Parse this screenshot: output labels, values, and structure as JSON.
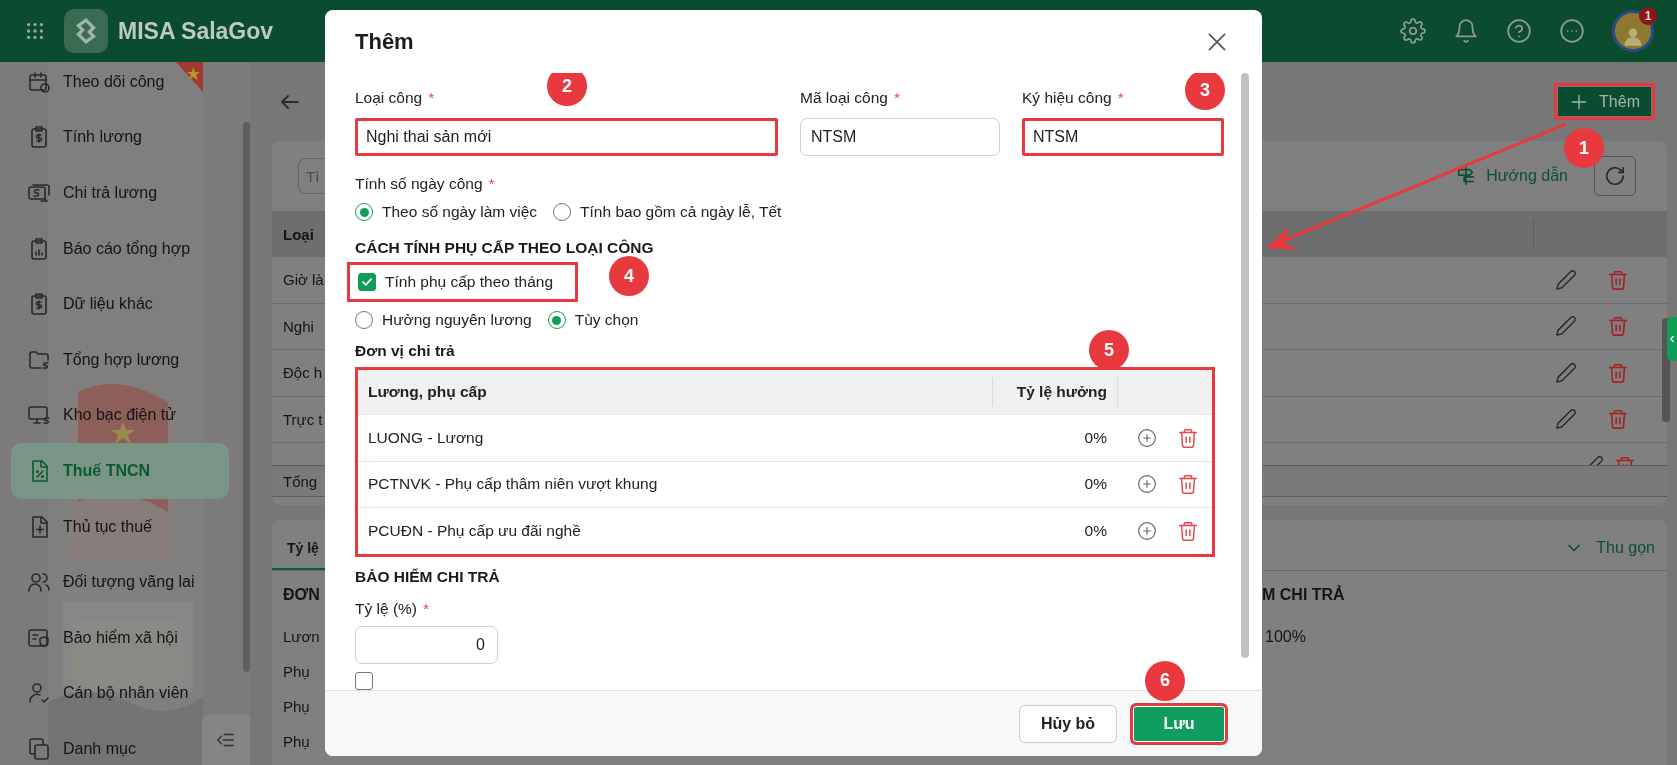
{
  "header": {
    "app_name": "MISA SalaGov",
    "notification_badge": "1"
  },
  "sidebar": {
    "items": [
      {
        "label": "Theo dõi công",
        "selected": false
      },
      {
        "label": "Tính lương",
        "selected": false
      },
      {
        "label": "Chi trả lương",
        "selected": false
      },
      {
        "label": "Báo cáo tổng hợp",
        "selected": false
      },
      {
        "label": "Dữ liệu khác",
        "selected": false
      },
      {
        "label": "Tổng hợp lương",
        "selected": false
      },
      {
        "label": "Kho bạc điện tử",
        "selected": false
      },
      {
        "label": "Thuế TNCN",
        "selected": true
      },
      {
        "label": "Thủ tục thuế",
        "selected": false
      },
      {
        "label": "Đối tượng vãng lai",
        "selected": false
      },
      {
        "label": "Bảo hiểm xã hội",
        "selected": false
      },
      {
        "label": "Cán bộ nhân viên",
        "selected": false
      },
      {
        "label": "Danh mục",
        "selected": false
      }
    ]
  },
  "page": {
    "add_button": {
      "label": "Thêm",
      "highlighted": true,
      "callout": "1"
    },
    "search_placeholder": "Tì",
    "guide_link": "Hướng dẫn",
    "table": {
      "column_1": "Loại",
      "rows": [
        "Giờ là",
        "Nghi",
        "Độc h",
        "Trực t"
      ],
      "footer": "Tổng"
    },
    "detail": {
      "tab": "Tỷ lệ",
      "collapse_link": "Thu gọn",
      "heading_1": "ĐƠN",
      "heading_2": "M CHI TRẢ",
      "lines": [
        "Lươn",
        "Phụ",
        "Phụ",
        "Phụ"
      ],
      "value": "100%"
    }
  },
  "dialog": {
    "title": "Thêm",
    "fields": [
      {
        "label": "Loại công",
        "mark": "*",
        "value": "Nghi thai sản mới",
        "highlighted": true,
        "callout": "2"
      },
      {
        "label": "Mã loại công",
        "mark": "*",
        "value": "NTSM",
        "highlighted": false
      },
      {
        "label": "Ký hiệu công",
        "mark": "*",
        "value": "NTSM",
        "highlighted": true,
        "callout": "3"
      }
    ],
    "workday": {
      "label": "Tính số ngày công",
      "mark": "*",
      "options": [
        {
          "label": "Theo số ngày làm việc",
          "selected": true
        },
        {
          "label": "Tính bao gồm cả ngày lễ, Tết",
          "selected": false
        }
      ]
    },
    "allowance_heading": "CÁCH TÍNH PHỤ CẤP THEO LOẠI CÔNG",
    "monthly_checkbox": {
      "label": "Tính phụ cấp theo tháng",
      "checked": true,
      "highlighted": true,
      "callout": "4"
    },
    "salary_options": [
      {
        "label": "Hưởng nguyên lương",
        "selected": false
      },
      {
        "label": "Tùy chọn",
        "selected": true
      }
    ],
    "payer": {
      "heading": "Đơn vị chi trả",
      "highlighted": true,
      "callout": "5",
      "columns": [
        "Lương, phụ cấp",
        "Tỷ lệ hưởng"
      ],
      "rows": [
        {
          "name": "LUONG - Lương",
          "rate": "0%"
        },
        {
          "name": "PCTNVK - Phụ cấp thâm niên vượt khung",
          "rate": "0%"
        },
        {
          "name": "PCUĐN - Phụ cấp ưu đãi nghề",
          "rate": "0%"
        }
      ]
    },
    "insurance_heading": "BẢO HIỂM CHI TRẢ",
    "rate_field": {
      "label": "Tỷ lệ (%)",
      "mark": "*",
      "value": "0"
    },
    "partial_checkbox": {
      "checked": false
    },
    "buttons": [
      {
        "label": "Hủy bỏ",
        "kind": "secondary",
        "highlighted": false
      },
      {
        "label": "Lưu",
        "kind": "primary",
        "highlighted": true,
        "callout": "6"
      }
    ]
  }
}
